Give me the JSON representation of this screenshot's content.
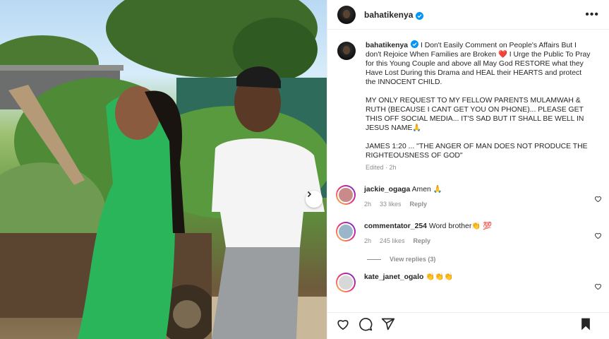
{
  "post": {
    "username": "bahatikenya",
    "more_icon": "more-horizontal-icon",
    "next_icon": "chevron-right-icon"
  },
  "caption": {
    "username": "bahatikenya",
    "paragraphs": [
      "I Don't Easily Comment on People's Affairs But I don't Rejoice When Families are Broken ❤️ I Urge the Public To Pray for this Young Couple and above all May God RESTORE what they Have Lost During this Drama and HEAL their HEARTS and protect the INNOCENT CHILD.",
      "MY ONLY REQUEST TO MY FELLOW PARENTS MULAMWAH & RUTH (BECAUSE I CANT GET YOU ON PHONE)... PLEASE GET THIS OFF SOCIAL MEDIA... IT'S SAD BUT IT SHALL BE WELL IN JESUS NAME🙏",
      "JAMES 1:20 ... \"THE ANGER OF MAN DOES NOT PRODUCE THE RIGHTEOUSNESS OF GOD\""
    ],
    "meta": "Edited · 2h"
  },
  "comments": [
    {
      "username": "jackie_ogaga",
      "text": "Amen 🙏",
      "time": "2h",
      "likes": "33 likes",
      "reply": "Reply",
      "avatar_color": "#c98a8a"
    },
    {
      "username": "commentator_254",
      "text": "Word brother👏 💯",
      "time": "2h",
      "likes": "245 likes",
      "reply": "Reply",
      "avatar_color": "#9ab6c9",
      "view_replies": "View replies (3)"
    },
    {
      "username": "kate_janet_ogalo",
      "text": "👏👏👏",
      "time": "",
      "likes": "",
      "reply": "",
      "avatar_color": "#d8d8d8"
    }
  ],
  "actions": [
    "heart-icon",
    "comment-icon",
    "share-icon",
    "bookmark-icon"
  ],
  "colors": {
    "verified": "#0095f6",
    "border": "#efefef",
    "muted": "#8e8e8e"
  }
}
